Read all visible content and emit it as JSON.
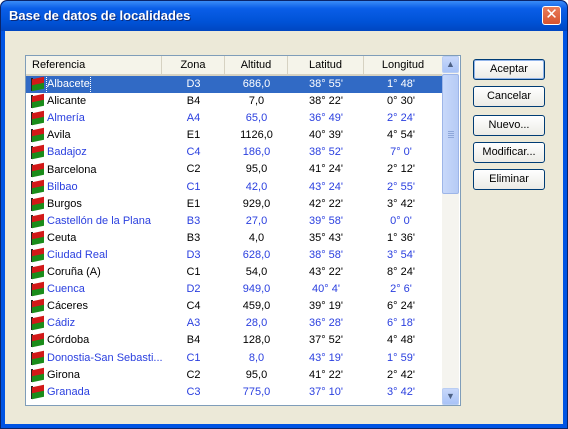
{
  "window": {
    "title": "Base de datos de localidades"
  },
  "title_controls": {
    "close_glyph": "✕"
  },
  "table": {
    "columns": [
      "Referencia",
      "Zona",
      "Altitud",
      "Latitud",
      "Longitud"
    ],
    "rows": [
      {
        "referencia": "Albacete",
        "zona": "D3",
        "altitud": "686,0",
        "latitud": "38° 55'",
        "longitud": "1° 48'",
        "color": "blue",
        "selected": true
      },
      {
        "referencia": "Alicante",
        "zona": "B4",
        "altitud": "7,0",
        "latitud": "38° 22'",
        "longitud": "0° 30'",
        "color": "black",
        "selected": false
      },
      {
        "referencia": "Almería",
        "zona": "A4",
        "altitud": "65,0",
        "latitud": "36° 49'",
        "longitud": "2° 24'",
        "color": "blue",
        "selected": false
      },
      {
        "referencia": "Avila",
        "zona": "E1",
        "altitud": "1126,0",
        "latitud": "40° 39'",
        "longitud": "4° 54'",
        "color": "black",
        "selected": false
      },
      {
        "referencia": "Badajoz",
        "zona": "C4",
        "altitud": "186,0",
        "latitud": "38° 52'",
        "longitud": "7° 0'",
        "color": "blue",
        "selected": false
      },
      {
        "referencia": "Barcelona",
        "zona": "C2",
        "altitud": "95,0",
        "latitud": "41° 24'",
        "longitud": "2° 12'",
        "color": "black",
        "selected": false
      },
      {
        "referencia": "Bilbao",
        "zona": "C1",
        "altitud": "42,0",
        "latitud": "43° 24'",
        "longitud": "2° 55'",
        "color": "blue",
        "selected": false
      },
      {
        "referencia": "Burgos",
        "zona": "E1",
        "altitud": "929,0",
        "latitud": "42° 22'",
        "longitud": "3° 42'",
        "color": "black",
        "selected": false
      },
      {
        "referencia": "Castellón de la Plana",
        "zona": "B3",
        "altitud": "27,0",
        "latitud": "39° 58'",
        "longitud": "0° 0'",
        "color": "blue",
        "selected": false
      },
      {
        "referencia": "Ceuta",
        "zona": "B3",
        "altitud": "4,0",
        "latitud": "35° 43'",
        "longitud": "1° 36'",
        "color": "black",
        "selected": false
      },
      {
        "referencia": "Ciudad Real",
        "zona": "D3",
        "altitud": "628,0",
        "latitud": "38° 58'",
        "longitud": "3° 54'",
        "color": "blue",
        "selected": false
      },
      {
        "referencia": "Coruña (A)",
        "zona": "C1",
        "altitud": "54,0",
        "latitud": "43° 22'",
        "longitud": "8° 24'",
        "color": "black",
        "selected": false
      },
      {
        "referencia": "Cuenca",
        "zona": "D2",
        "altitud": "949,0",
        "latitud": "40° 4'",
        "longitud": "2° 6'",
        "color": "blue",
        "selected": false
      },
      {
        "referencia": "Cáceres",
        "zona": "C4",
        "altitud": "459,0",
        "latitud": "39° 19'",
        "longitud": "6° 24'",
        "color": "black",
        "selected": false
      },
      {
        "referencia": "Cádiz",
        "zona": "A3",
        "altitud": "28,0",
        "latitud": "36° 28'",
        "longitud": "6° 18'",
        "color": "blue",
        "selected": false
      },
      {
        "referencia": "Córdoba",
        "zona": "B4",
        "altitud": "128,0",
        "latitud": "37° 52'",
        "longitud": "4° 48'",
        "color": "black",
        "selected": false
      },
      {
        "referencia": "Donostia-San Sebasti...",
        "zona": "C1",
        "altitud": "8,0",
        "latitud": "43° 19'",
        "longitud": "1° 59'",
        "color": "blue",
        "selected": false
      },
      {
        "referencia": "Girona",
        "zona": "C2",
        "altitud": "95,0",
        "latitud": "41° 22'",
        "longitud": "2° 42'",
        "color": "black",
        "selected": false
      },
      {
        "referencia": "Granada",
        "zona": "C3",
        "altitud": "775,0",
        "latitud": "37° 10'",
        "longitud": "3° 42'",
        "color": "blue",
        "selected": false
      }
    ]
  },
  "scrollbar": {
    "up_glyph": "▲",
    "down_glyph": "▼"
  },
  "buttons": {
    "accept": "Aceptar",
    "cancel": "Cancelar",
    "new": "Nuevo...",
    "modify": "Modificar...",
    "delete": "Eliminar"
  },
  "colors": {
    "blue_row_text": "#2a3fdf",
    "selection": "#316ac5",
    "titlebar": "#0054e3",
    "dialog_bg": "#ece9d8"
  },
  "icons": {
    "row_icon": "spanish-flag-icon"
  }
}
